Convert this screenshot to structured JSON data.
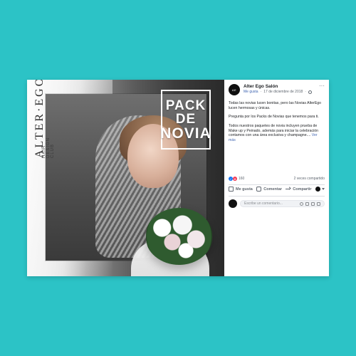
{
  "post": {
    "page_name": "Alter Ego Salón",
    "meta": {
      "like_label": "Me gusta",
      "separator": "·",
      "date": "17 de diciembre de 2018",
      "separator2": "·"
    },
    "text_paragraphs": [
      "Todas las novias lucen bonitas, pero las Novias AlterEgo lucen hermosas y únicas.",
      "Pregunta por los Packs de Novias que tenemos para ti.",
      "Todos nuestros paquetes de novia incluyen prueba de Make up y Peinado, además para iniciar la celebración contamos con una área exclusiva y champagne...."
    ],
    "see_more": "Ver más",
    "reactions_count": "160",
    "shares": "2 veces compartido",
    "actions": {
      "like": "Me gusta",
      "comment": "Comentar",
      "share": "Compartir"
    },
    "comment_placeholder": "Escribe un comentario..."
  },
  "image": {
    "pack_line1": "PACK",
    "pack_line2": "DE",
    "pack_line3": "NOVIA",
    "brand_main": "ALTER·EGO",
    "brand_sub": "HAIR DESIGN CLUB"
  },
  "colors": {
    "background": "#2cc3c6",
    "facebook_blue": "#4267b2",
    "like_blue": "#1877f2",
    "love_red": "#f33e58"
  }
}
